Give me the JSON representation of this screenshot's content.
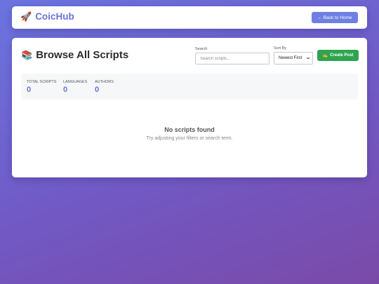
{
  "header": {
    "brand_icon": "rocket-icon",
    "brand_name": "CoicHub",
    "back_button": "← Back to Home"
  },
  "main": {
    "title_icon": "books-icon",
    "title": "Browse All Scripts",
    "search": {
      "label": "Search",
      "placeholder": "Search scripts...",
      "value": ""
    },
    "sort": {
      "label": "Sort By",
      "selected": "Newest First"
    },
    "create_button": {
      "icon": "pencil-icon",
      "label": "Create Post"
    },
    "stats": [
      {
        "label": "Total Scripts",
        "value": "0"
      },
      {
        "label": "Languages",
        "value": "0"
      },
      {
        "label": "Authors",
        "value": "0"
      }
    ],
    "empty": {
      "title": "No scripts found",
      "subtitle": "Try adjusting your filters or search term."
    }
  },
  "colors": {
    "accent": "#6a73d6",
    "button_primary": "#6f80e2",
    "button_success": "#2ea44f",
    "background_start": "#6a74e0",
    "background_end": "#7a4aa8"
  }
}
